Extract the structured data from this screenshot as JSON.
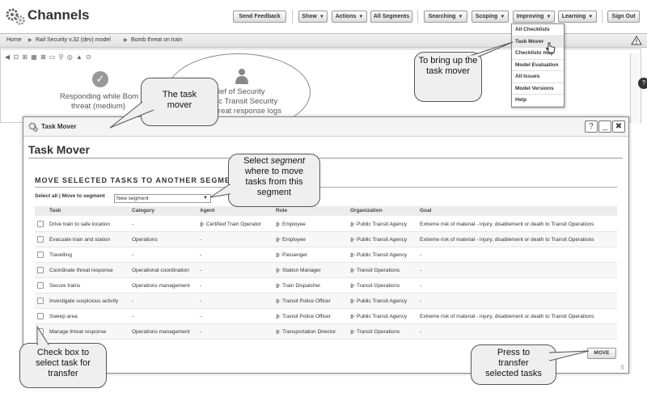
{
  "header": {
    "app_title": "Channels",
    "buttons": {
      "send_feedback": "Send Feedback",
      "show": "Show",
      "actions": "Actions",
      "all_segments": "All Segments",
      "searching": "Searching",
      "scoping": "Scoping",
      "improving": "Improving",
      "learning": "Learning",
      "sign_out": "Sign Out"
    }
  },
  "breadcrumb": [
    "Home",
    "Rail Security v.32 (dev) model",
    "Bomb threat on train"
  ],
  "background": {
    "responding_line1": "Responding while Bom",
    "responding_line2": "threat (medium)",
    "ellipse_line1": "ief of Security",
    "ellipse_line2": "lic Transit Security",
    "ellipse_line3": "threat response logs"
  },
  "improving_menu": {
    "items": [
      "All Checklists",
      "Task Mover",
      "Checklists map",
      "Model Evaluation",
      "All Issues",
      "Model Versions",
      "Help"
    ],
    "active_index": 1
  },
  "dialog": {
    "window_title": "Task Mover",
    "page_title": "Task Mover",
    "section_title": "MOVE SELECTED TASKS TO ANOTHER SEGMENT",
    "select_all": "Select all",
    "move_to_segment": "| Move to segment",
    "segment_value": "New segment",
    "columns": [
      "Task",
      "Category",
      "Agent",
      "Role",
      "Organization",
      "Goal"
    ],
    "rows": [
      {
        "task": "Drive train to safe location",
        "category": "-",
        "agent": "Certified Train Operator",
        "role": "Employee",
        "organization": "Public Transit Agency",
        "goal": "Extreme risk of material - injury, disablement or death to Transit Operations"
      },
      {
        "task": "Evacuate train and station",
        "category": "Operations",
        "agent": "-",
        "role": "Employee",
        "organization": "Public Transit Agency",
        "goal": "Extreme risk of material - injury, disablement or death to Transit Operations"
      },
      {
        "task": "Travelling",
        "category": "-",
        "agent": "-",
        "role": "Passenger",
        "organization": "Public Transit Agency",
        "goal": "-"
      },
      {
        "task": "Coordinate threat response",
        "category": "Operational coordination",
        "agent": "-",
        "role": "Station Manager",
        "organization": "Transit Operations",
        "goal": "-"
      },
      {
        "task": "Secure trains",
        "category": "Operations management",
        "agent": "-",
        "role": "Train Dispatcher",
        "organization": "Transit Operations",
        "goal": "-"
      },
      {
        "task": "Investigate suspicious activity",
        "category": "-",
        "agent": "-",
        "role": "Transit Police Officer",
        "organization": "Public Transit Agency",
        "goal": "-"
      },
      {
        "task": "Sweep area",
        "category": "-",
        "agent": "-",
        "role": "Transit Police Officer",
        "organization": "Public Transit Agency",
        "goal": "Extreme risk of material - injury, disablement or death to Transit Operations"
      },
      {
        "task": "Manage threat response",
        "category": "Operations management",
        "agent": "-",
        "role": "Transportation Director",
        "organization": "Transit Operations",
        "goal": "-"
      }
    ],
    "move_button": "MOVE"
  },
  "callouts": {
    "task_mover": "The task mover",
    "bring_up": "To bring up the task mover",
    "select_segment_l1": "Select",
    "select_segment_em": "segment",
    "select_segment_l2": "where to move",
    "select_segment_l3": "tasks from this",
    "select_segment_l4": "segment",
    "check_box": "Check box to select task for transfer",
    "press": "Press to transfer selected tasks"
  }
}
